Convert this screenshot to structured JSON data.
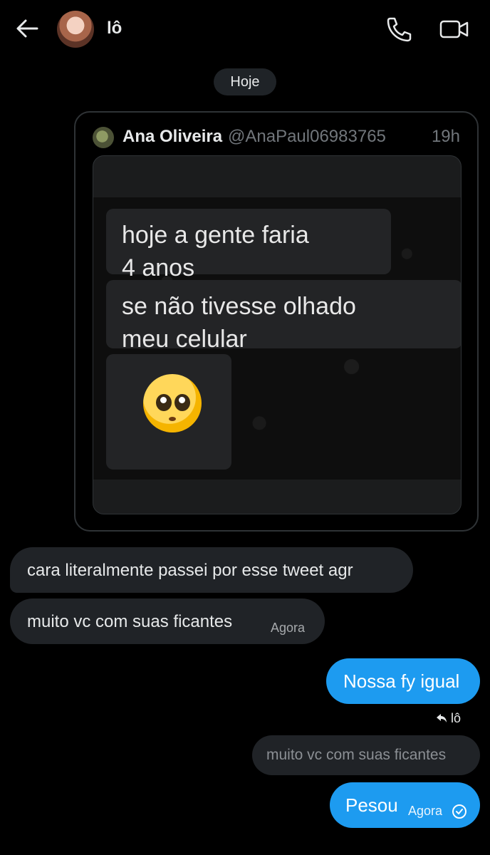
{
  "header": {
    "back_icon": "arrow-left-icon",
    "contact_name": "lô",
    "call_icon": "phone-icon",
    "video_icon": "video-camera-icon"
  },
  "date_separator": "Hoje",
  "quoted_tweet": {
    "author_name": "Ana Oliveira",
    "author_handle": "@AnaPaul06983765",
    "time": "19h",
    "media": {
      "message_1": "hoje a gente faria\n4 anos",
      "message_2": "se não tivesse olhado\nmeu celular",
      "emoji": "🥺"
    }
  },
  "messages": {
    "incoming_1": {
      "text": "cara literalmente passei por esse tweet agr"
    },
    "incoming_2": {
      "text": "muito vc com suas ficantes",
      "time": "Agora"
    },
    "outgoing_1": {
      "text": "Nossa fy igual"
    },
    "reply_indicator": {
      "icon": "reply-arrow-icon",
      "label": "lô"
    },
    "reply_quote": {
      "text": "muito vc com suas ficantes"
    },
    "outgoing_2": {
      "text": "Pesou",
      "time": "Agora",
      "status_icon": "read-check-icon"
    }
  },
  "colors": {
    "background": "#000000",
    "incoming_bubble": "#202327",
    "outgoing_bubble": "#1d9bf0",
    "secondary_text": "#71767b"
  }
}
